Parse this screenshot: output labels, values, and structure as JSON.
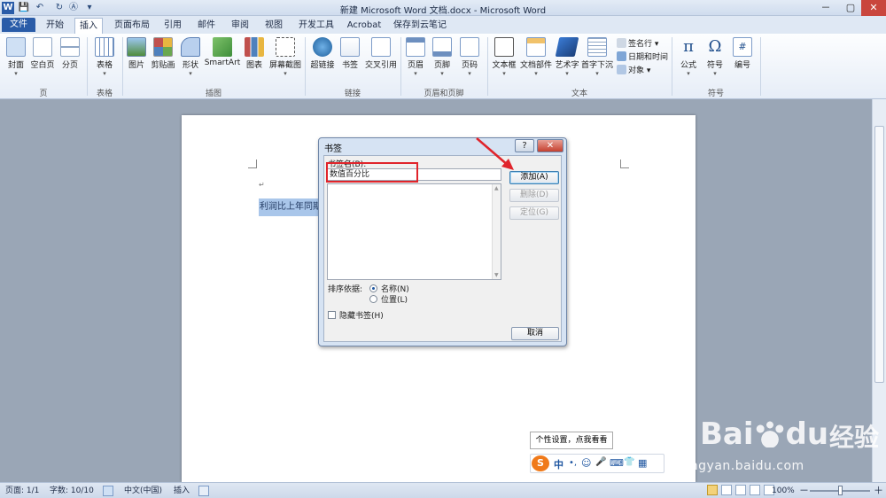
{
  "window": {
    "title": "新建 Microsoft Word 文档.docx - Microsoft Word"
  },
  "quick_access": [
    "W",
    "💾",
    "↶",
    "↻",
    "Ⓐ",
    "▾"
  ],
  "window_controls": [
    "－",
    "▢",
    "✕"
  ],
  "tabs": [
    "文件",
    "开始",
    "插入",
    "页面布局",
    "引用",
    "邮件",
    "审阅",
    "视图",
    "开发工具",
    "Acrobat",
    "保存到云笔记"
  ],
  "ribbon": {
    "page": {
      "items": [
        "封面",
        "空白页",
        "分页"
      ],
      "group": "页"
    },
    "table": {
      "items": [
        "表格"
      ],
      "group": "表格"
    },
    "illus": {
      "items": [
        "图片",
        "剪贴画",
        "形状",
        "SmartArt",
        "图表",
        "屏幕截图"
      ],
      "group": "插图"
    },
    "links": {
      "items": [
        "超链接",
        "书签",
        "交叉引用"
      ],
      "group": "链接"
    },
    "hf": {
      "items": [
        "页眉",
        "页脚",
        "页码"
      ],
      "group": "页眉和页脚"
    },
    "text": {
      "items": [
        "文本框",
        "文档部件",
        "艺术字",
        "首字下沉"
      ],
      "small": [
        "签名行 ▾",
        "日期和时间",
        "对象 ▾"
      ],
      "group": "文本"
    },
    "symbols": {
      "items": [
        "公式",
        "符号",
        "编号"
      ],
      "group": "符号"
    }
  },
  "document": {
    "selected_text": "利润比上年同期"
  },
  "dialog": {
    "title": "书签",
    "help": "?",
    "close": "✕",
    "name_label": "书签名(B):",
    "name_value": "数值百分比",
    "add": "添加(A)",
    "delete": "删除(D)",
    "goto": "定位(G)",
    "sort_label": "排序依据:",
    "sort_name": "名称(N)",
    "sort_position": "位置(L)",
    "hidden": "隐藏书签(H)",
    "cancel": "取消"
  },
  "status": {
    "page": "页面: 1/1",
    "words": "字数: 10/10",
    "lang": "中文(中国)",
    "mode": "插入",
    "zoom": "100%",
    "zoom_out": "－",
    "zoom_in": "＋"
  },
  "ime": {
    "tip": "个性设置，点我看看",
    "logo": "S",
    "mode": "中",
    "items": [
      "•,",
      "☺",
      "🎤",
      "⌨",
      "👕",
      "▦"
    ]
  },
  "watermark": {
    "brand": "Bai",
    "brand2": "du",
    "word": "经验",
    "url": "jingyan.baidu.com"
  },
  "colors": {
    "accent": "#2a5ca8",
    "annotation": "#e0242b",
    "selection": "#a9c6ea"
  }
}
